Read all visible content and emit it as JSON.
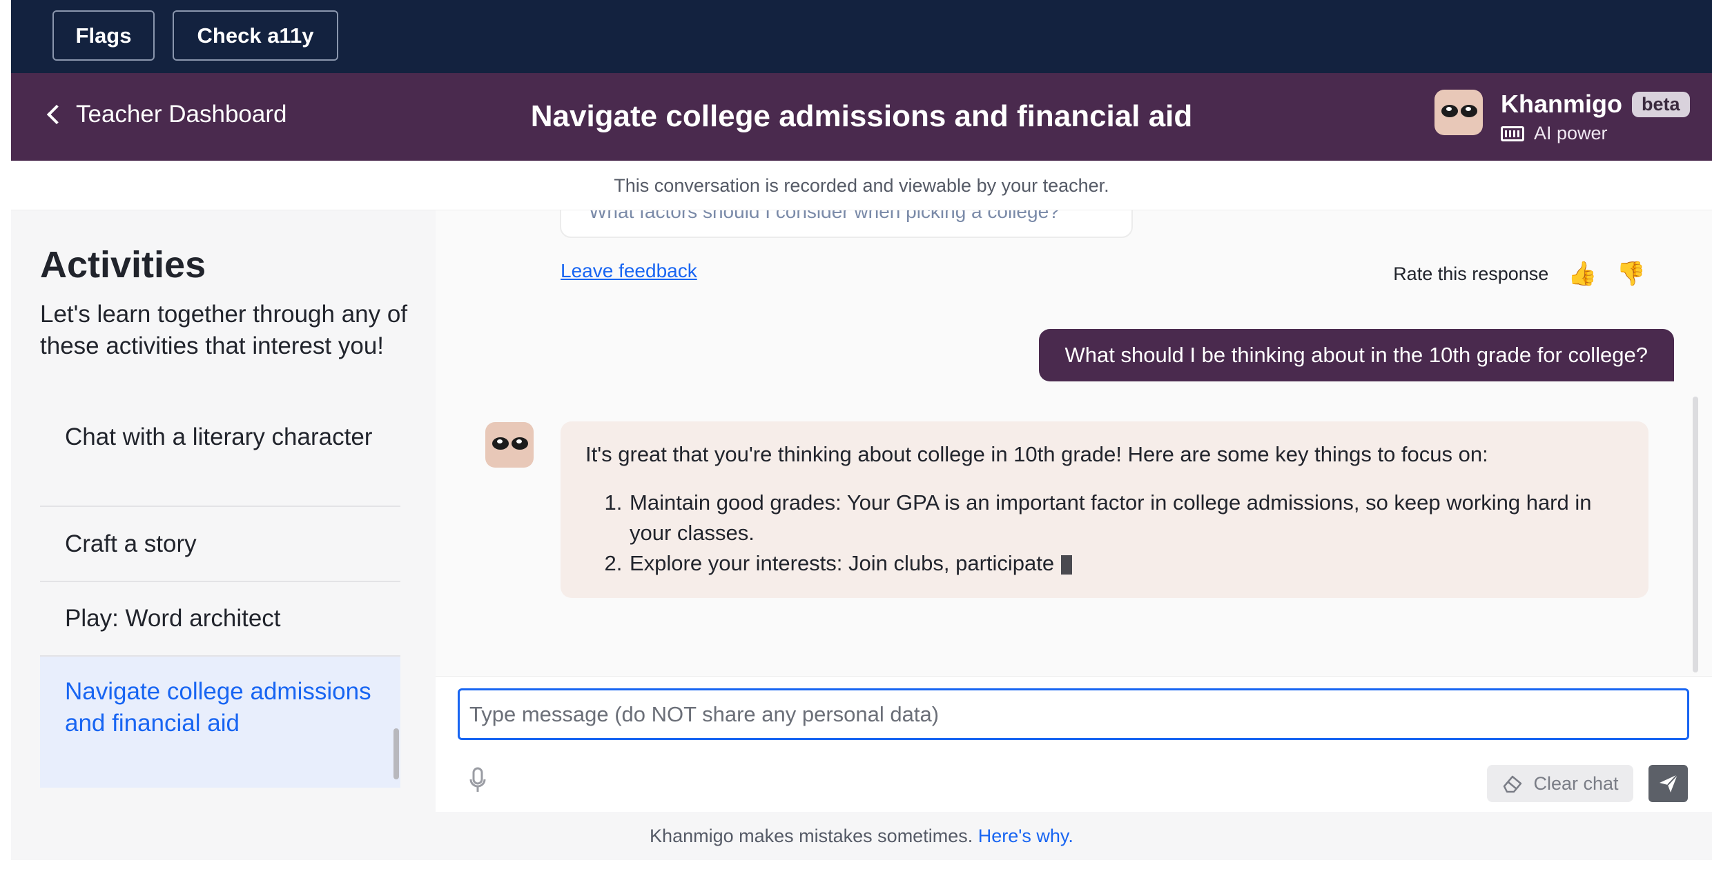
{
  "devbar": {
    "flags_label": "Flags",
    "a11y_label": "Check a11y"
  },
  "header": {
    "back_label": "Teacher Dashboard",
    "title": "Navigate college admissions and financial aid",
    "brand_name": "Khanmigo",
    "beta_label": "beta",
    "ai_power_label": "AI power"
  },
  "notice": "This conversation is recorded and viewable by your teacher.",
  "sidebar": {
    "title": "Activities",
    "subtitle": "Let's learn together through any of these activities that interest you!",
    "items": [
      {
        "label": "Chat with a literary character"
      },
      {
        "label": "Craft a story"
      },
      {
        "label": "Play: Word architect"
      },
      {
        "label": "Navigate college admissions and financial aid"
      }
    ]
  },
  "chat": {
    "previous_snippet": "What factors should I consider when picking a college?",
    "leave_feedback": "Leave feedback",
    "rate_label": "Rate this response",
    "user_message": "What should I be thinking about in the 10th grade for college?",
    "bot_intro": "It's great that you're thinking about college in 10th grade! Here are some key things to focus on:",
    "bot_points": [
      "Maintain good grades: Your GPA is an important factor in college admissions, so keep working hard in your classes.",
      "Explore your interests: Join clubs, participate"
    ]
  },
  "composer": {
    "placeholder": "Type message (do NOT share any personal data)",
    "clear_label": "Clear chat"
  },
  "footer": {
    "text": "Khanmigo makes mistakes sometimes.",
    "link": "Here's why."
  },
  "colors": {
    "header_bg": "#4a2a4e",
    "devbar_bg": "#13223f",
    "accent": "#1865f2",
    "bot_bubble": "#f6ede9"
  }
}
